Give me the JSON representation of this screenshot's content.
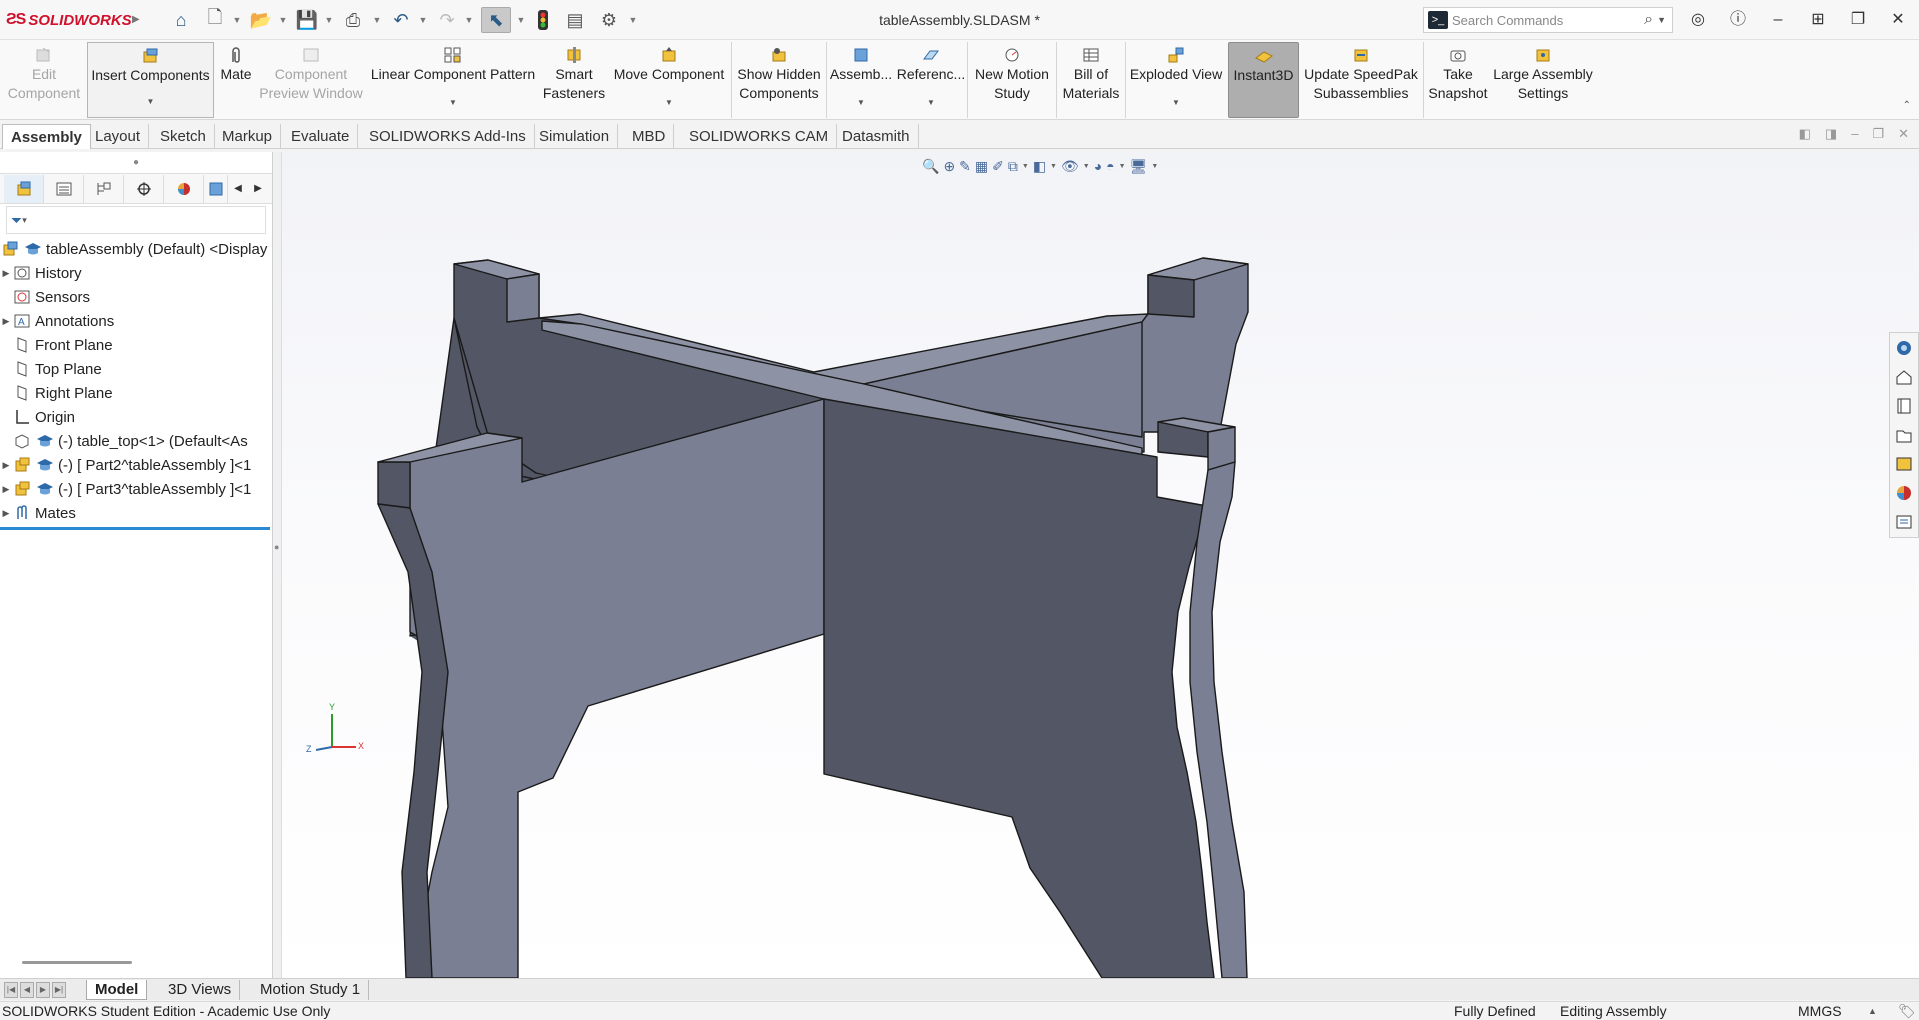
{
  "app": {
    "brand": "SOLIDWORKS",
    "document_title": "tableAssembly.SLDASM *"
  },
  "search": {
    "placeholder": "Search Commands"
  },
  "ribbon": {
    "buttons": [
      {
        "label1": "Edit",
        "label2": "Component"
      },
      {
        "label1": "Insert Components",
        "label2": ""
      },
      {
        "label1": "Mate",
        "label2": ""
      },
      {
        "label1": "Component",
        "label2": "Preview Window"
      },
      {
        "label1": "Linear Component Pattern",
        "label2": ""
      },
      {
        "label1": "Smart",
        "label2": "Fasteners"
      },
      {
        "label1": "Move Component",
        "label2": ""
      },
      {
        "label1": "Show Hidden",
        "label2": "Components"
      },
      {
        "label1": "Assemb...",
        "label2": ""
      },
      {
        "label1": "Referenc...",
        "label2": ""
      },
      {
        "label1": "New Motion",
        "label2": "Study"
      },
      {
        "label1": "Bill of",
        "label2": "Materials"
      },
      {
        "label1": "Exploded View",
        "label2": ""
      },
      {
        "label1": "Instant3D",
        "label2": ""
      },
      {
        "label1": "Update SpeedPak",
        "label2": "Subassemblies"
      },
      {
        "label1": "Take",
        "label2": "Snapshot"
      },
      {
        "label1": "Large Assembly",
        "label2": "Settings"
      }
    ]
  },
  "tabs": [
    "Assembly",
    "Layout",
    "Sketch",
    "Markup",
    "Evaluate",
    "SOLIDWORKS Add-Ins",
    "Simulation",
    "MBD",
    "SOLIDWORKS CAM",
    "Datasmith"
  ],
  "tree": {
    "root": "tableAssembly (Default) <Display",
    "items": [
      {
        "label": "History"
      },
      {
        "label": "Sensors"
      },
      {
        "label": "Annotations"
      },
      {
        "label": "Front Plane"
      },
      {
        "label": "Top Plane"
      },
      {
        "label": "Right Plane"
      },
      {
        "label": "Origin"
      },
      {
        "label": "(-) table_top<1> (Default<As"
      },
      {
        "label": "(-) [ Part2^tableAssembly ]<1"
      },
      {
        "label": "(-) [ Part3^tableAssembly ]<1"
      },
      {
        "label": "Mates"
      }
    ]
  },
  "triad": {
    "x": "X",
    "y": "Y",
    "z": "Z"
  },
  "bottom_tabs": [
    "Model",
    "3D Views",
    "Motion Study 1"
  ],
  "status": {
    "left": "SOLIDWORKS Student Edition - Academic Use Only",
    "defined": "Fully Defined",
    "mode": "Editing Assembly",
    "units": "MMGS"
  },
  "colors": {
    "accent": "#2a8ad4",
    "part_light": "#7b7f93",
    "part_dark": "#535665",
    "part_top": "#8e92a5",
    "brand_red": "#d0112b"
  }
}
